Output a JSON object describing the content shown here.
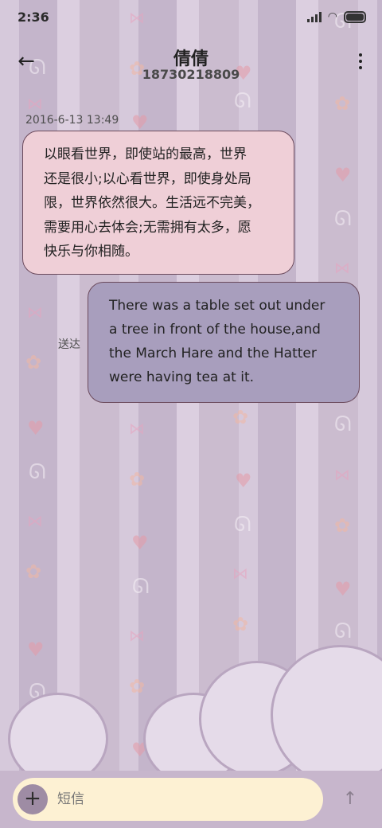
{
  "status_bar": {
    "time": "2:36",
    "icons": [
      "signal-icon",
      "wifi-icon",
      "battery-icon"
    ]
  },
  "header": {
    "contact_name": "倩倩",
    "contact_number": "18730218809",
    "back_icon": "back-arrow-icon",
    "more_icon": "more-vertical-icon"
  },
  "conversation": {
    "timestamp": "2016-6-13 13:49",
    "messages": [
      {
        "direction": "incoming",
        "lines": [
          "以眼看世界，即使站的最高，世界",
          "还是很小;以心看世界，即使身处局",
          "限，世界依然很大。生活远不完美，",
          "需要用心去体会;无需拥有太多，愿",
          "快乐与你相随。"
        ]
      },
      {
        "direction": "outgoing",
        "status": "送达",
        "lines": [
          "There was a table set out under",
          "a tree in front of the house,and",
          "the March Hare and the Hatter",
          "were having tea at it."
        ]
      }
    ]
  },
  "composer": {
    "add_icon": "plus-icon",
    "placeholder": "短信",
    "value": "",
    "send_icon": "arrow-up-icon"
  },
  "colors": {
    "incoming_bubble": "#efcfd7",
    "outgoing_bubble": "#a89ebd",
    "composer_pill": "#fdf1d3",
    "theme_background": "#cdbfd3"
  }
}
